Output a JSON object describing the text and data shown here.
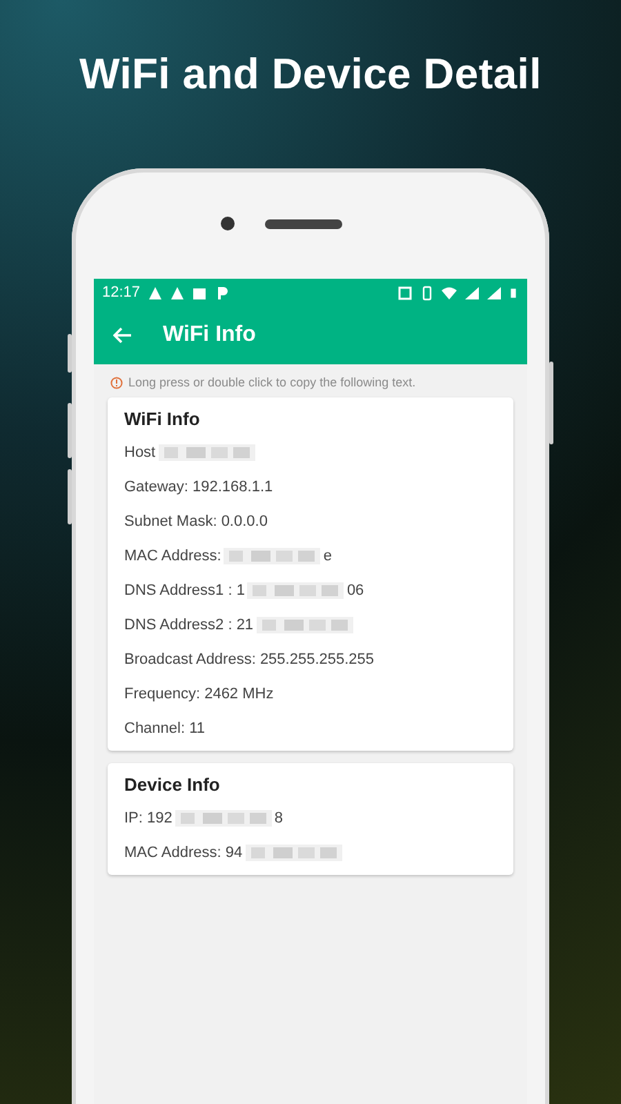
{
  "headline": "WiFi and Device Detail",
  "status_bar": {
    "time": "12:17"
  },
  "app_bar": {
    "title": "WiFi Info"
  },
  "hint": "Long press or double click to copy the following text.",
  "cards": [
    {
      "title": "WiFi Info",
      "rows": [
        {
          "label": "Host",
          "redacted": true
        },
        {
          "label": "Gateway: 192.168.1.1",
          "redacted": false
        },
        {
          "label": "Subnet Mask: 0.0.0.0",
          "redacted": false
        },
        {
          "label": "MAC Address:",
          "redacted": true,
          "suffix": "e"
        },
        {
          "label": "DNS Address1 : 1",
          "redacted": true,
          "suffix": "06"
        },
        {
          "label": "DNS Address2 : 21",
          "redacted": true
        },
        {
          "label": "Broadcast Address: 255.255.255.255",
          "redacted": false
        },
        {
          "label": "Frequency: 2462 MHz",
          "redacted": false
        },
        {
          "label": "Channel: 11",
          "redacted": false
        }
      ]
    },
    {
      "title": "Device Info",
      "rows": [
        {
          "label": "IP: 192",
          "redacted": true,
          "suffix": "8"
        },
        {
          "label": "MAC Address: 94",
          "redacted": true
        }
      ]
    }
  ]
}
